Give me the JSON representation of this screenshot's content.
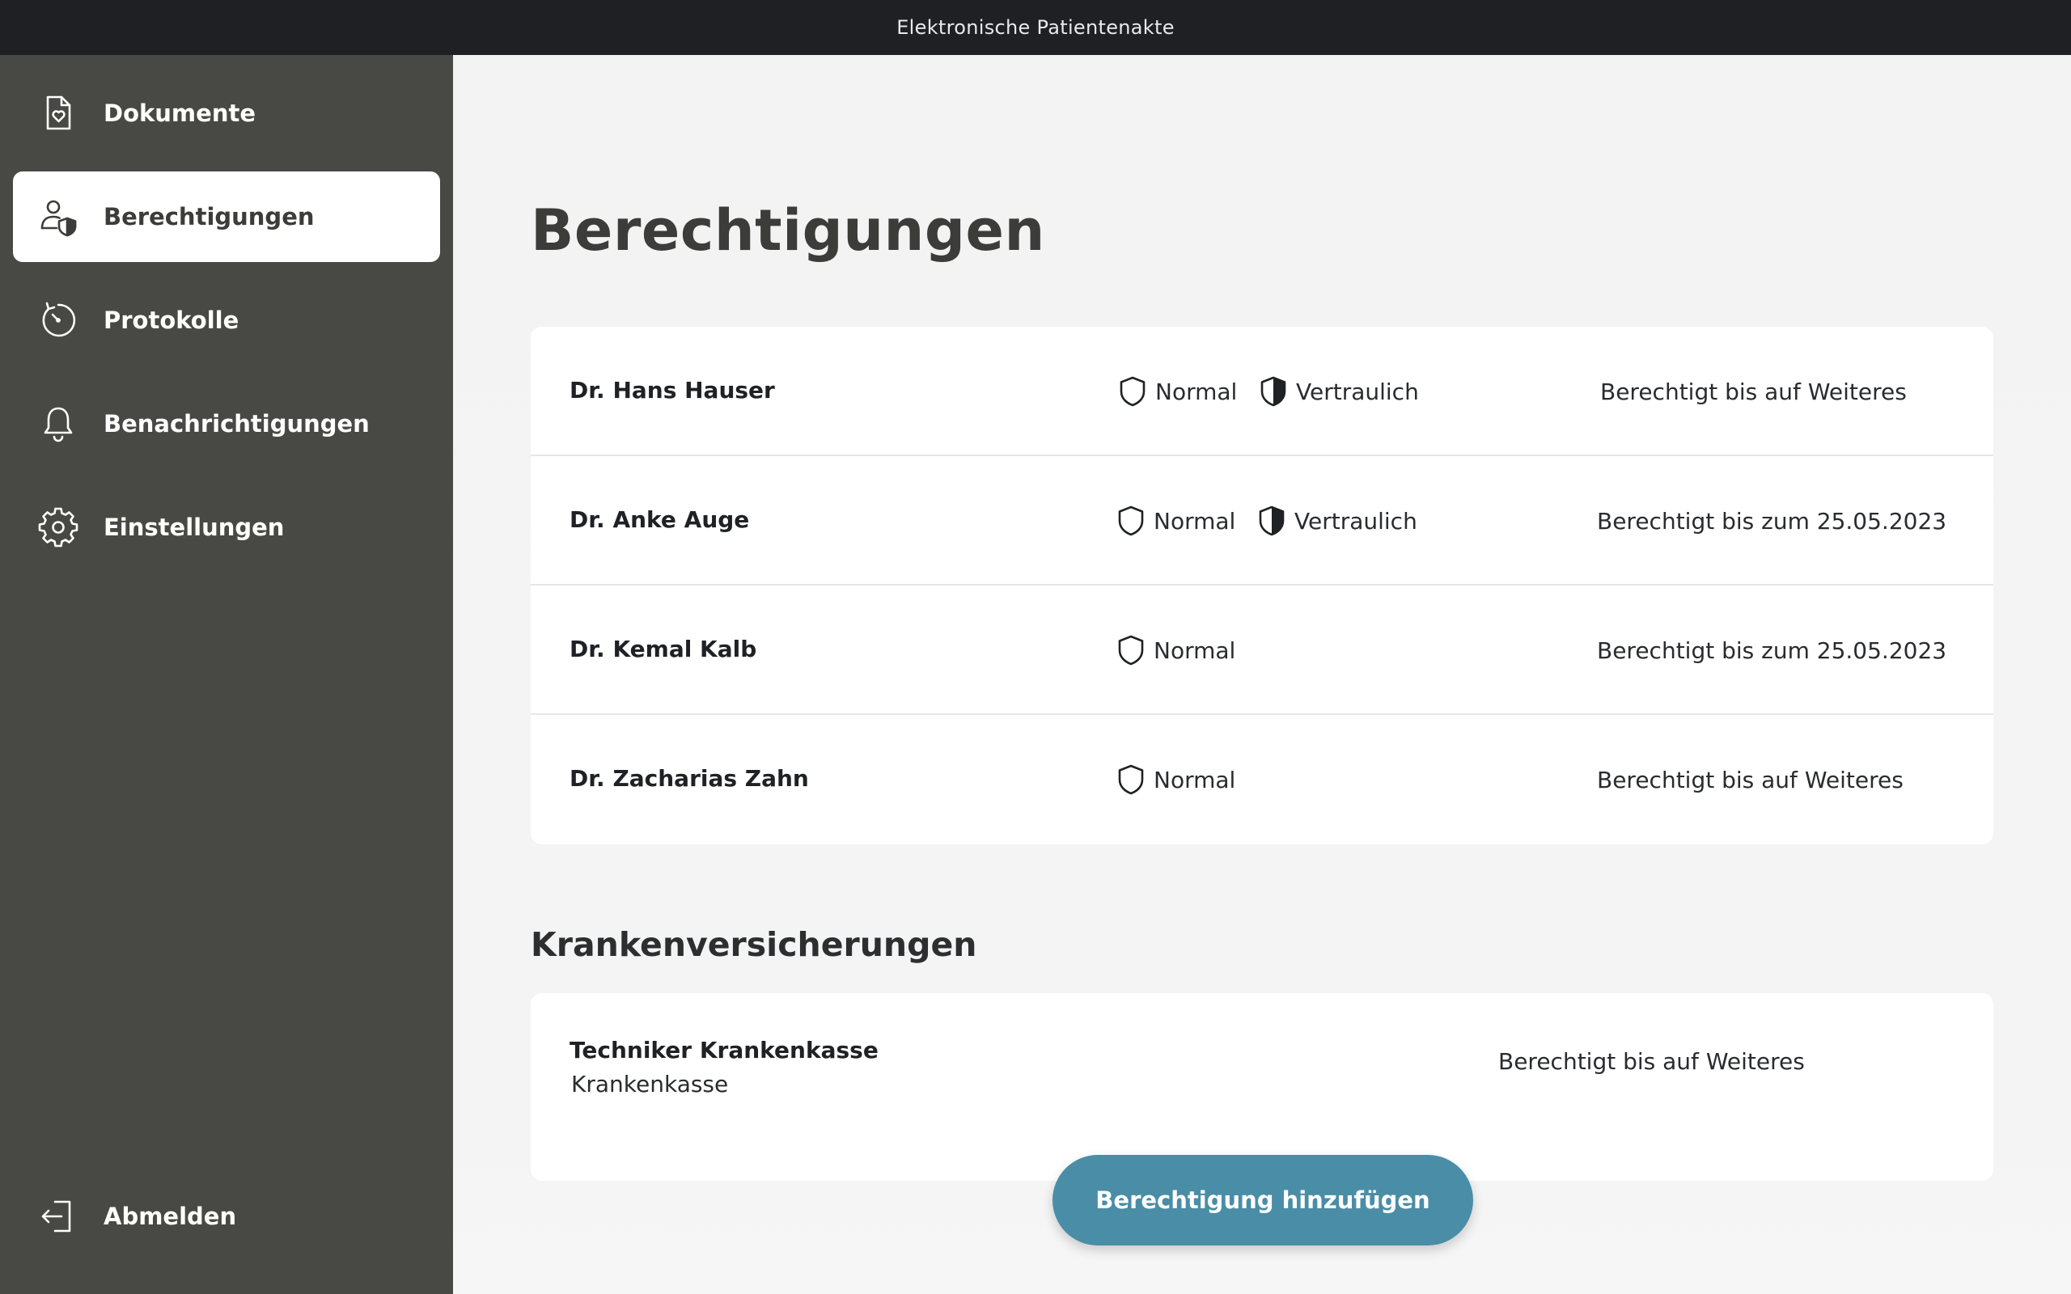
{
  "window": {
    "title": "Elektronische Patientenakte"
  },
  "sidebar": {
    "items": [
      {
        "label": "Dokumente",
        "icon": "document-heart-icon",
        "active": false
      },
      {
        "label": "Berechtigungen",
        "icon": "user-shield-icon",
        "active": true
      },
      {
        "label": "Protokolle",
        "icon": "history-dial-icon",
        "active": false
      },
      {
        "label": "Benachrichtigungen",
        "icon": "bell-icon",
        "active": false
      },
      {
        "label": "Einstellungen",
        "icon": "gear-icon",
        "active": false
      }
    ],
    "logout": {
      "label": "Abmelden",
      "icon": "logout-icon"
    }
  },
  "main": {
    "title": "Berechtigungen",
    "permissions": [
      {
        "name": "Dr. Hans Hauser",
        "levels": [
          "Normal",
          "Vertraulich"
        ],
        "status": "Berechtigt bis auf Weiteres"
      },
      {
        "name": "Dr. Anke Auge",
        "levels": [
          "Normal",
          "Vertraulich"
        ],
        "status": "Berechtigt bis zum 25.05.2023"
      },
      {
        "name": "Dr. Kemal Kalb",
        "levels": [
          "Normal"
        ],
        "status": "Berechtigt bis zum 25.05.2023"
      },
      {
        "name": "Dr. Zacharias Zahn",
        "levels": [
          "Normal"
        ],
        "status": "Berechtigt bis auf Weiteres"
      }
    ],
    "insurance_section_title": "Krankenversicherungen",
    "insurances": [
      {
        "name": "Techniker Krankenkasse",
        "type": "Krankenkasse",
        "status": "Berechtigt bis auf Weiteres"
      }
    ],
    "add_button_label": "Berechtigung hinzufügen"
  },
  "colors": {
    "titlebar": "#1f2024",
    "sidebar": "#484944",
    "accent": "#4a8da7",
    "background": "#f4f4f4"
  }
}
